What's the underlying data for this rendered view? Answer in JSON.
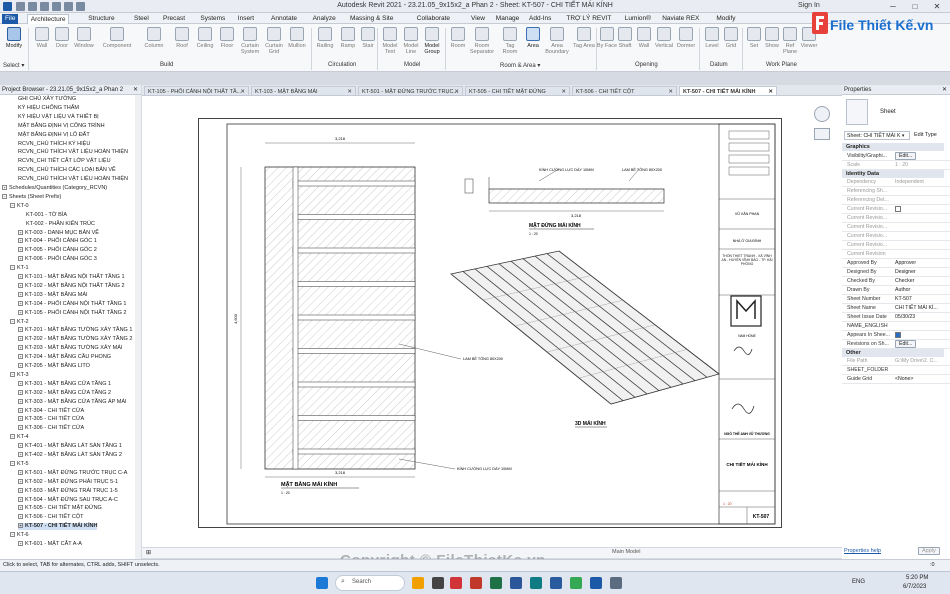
{
  "window": {
    "title": "Autodesk Revit 2021 - 23.21.05_9x15x2_a Phan 2 - Sheet: KT-507 - CHI TIẾT MÁI KÍNH",
    "sign_in": "Sign In",
    "controls": [
      "─",
      "□",
      "✕"
    ]
  },
  "menu": {
    "tabs": [
      "File",
      "Architecture",
      "Structure",
      "Steel",
      "Precast",
      "Systems",
      "Insert",
      "Annotate",
      "Analyze",
      "Massing & Site",
      "Collaborate",
      "View",
      "Manage",
      "Add-Ins",
      "TRỢ LÝ REVIT",
      "Lumion®",
      "Naviate REX",
      "Modify"
    ],
    "active": "Architecture"
  },
  "ribbon": {
    "buttons": {
      "modify": "Modify",
      "wall": "Wall",
      "door": "Door",
      "window": "Window",
      "component": "Component",
      "column": "Column",
      "roof": "Roof",
      "ceiling": "Ceiling",
      "floor": "Floor",
      "curtain_system": "Curtain System",
      "curtain_grid": "Curtain Grid",
      "mullion": "Mullion",
      "railing": "Railing",
      "ramp": "Ramp",
      "stair": "Stair",
      "model_text": "Model Text",
      "model_line": "Model Line",
      "model_group": "Model Group",
      "room": "Room",
      "room_separator": "Room Separator",
      "tag_room": "Tag Room",
      "area": "Area",
      "area_boundary": "Area Boundary",
      "tag_area": "Tag Area",
      "by_face": "By Face",
      "shaft": "Shaft",
      "wall_opening": "Wall",
      "vertical": "Vertical",
      "dormer": "Dormer",
      "level": "Level",
      "grid": "Grid",
      "set": "Set",
      "show": "Show",
      "ref_plane": "Ref Plane",
      "viewer": "Viewer"
    },
    "groups": {
      "select": "Select ▾",
      "build": "Build",
      "circulation": "Circulation",
      "model": "Model",
      "room_area": "Room & Area ▾",
      "opening": "Opening",
      "datum": "Datum",
      "work_plane": "Work Plane"
    },
    "logo_text": "File Thiết Kế.vn"
  },
  "project_browser": {
    "title": "Project Browser - 23.21.05_9x15x2_a Phan 2",
    "close": "✕",
    "items": [
      {
        "label": "GHI CHÚ XÂY TƯỜNG",
        "indent": 2
      },
      {
        "label": "KÝ HIỆU CHỐNG THẤM",
        "indent": 2
      },
      {
        "label": "KÝ HIỆU VẬT LIỆU VÀ THIẾT BỊ",
        "indent": 2
      },
      {
        "label": "MẶT BẰNG ĐỊNH VỊ CÔNG TRÌNH",
        "indent": 2
      },
      {
        "label": "MẶT BẰNG ĐỊNH VỊ LÔ ĐẤT",
        "indent": 2
      },
      {
        "label": "RCVN_CHÚ THÍCH KÝ HIỆU",
        "indent": 2
      },
      {
        "label": "RCVN_CHÚ THÍCH VẬT LIỆU HOÀN THIỆN",
        "indent": 2
      },
      {
        "label": "RCVN_CHI TIẾT CẮT LỚP VẬT LIỆU",
        "indent": 2
      },
      {
        "label": "RCVN_CHÚ THÍCH CÁC LOẠI BẢN VẼ",
        "indent": 2
      },
      {
        "label": "RCVN_CHÚ THÍCH VẬT LIỆU HOÀN THIỆN",
        "indent": 2
      },
      {
        "label": "Schedules/Quantities (Category_RCVN)",
        "indent": 0,
        "exp": "+"
      },
      {
        "label": "Sheets (Sheet Prefix)",
        "indent": 0,
        "exp": "−"
      },
      {
        "label": "KT-0",
        "indent": 1,
        "exp": "−"
      },
      {
        "label": "KT-001 - TỜ BÌA",
        "indent": 3
      },
      {
        "label": "KT-002 - PHẦN KIẾN TRÚC",
        "indent": 3
      },
      {
        "label": "KT-003 - DANH MỤC BẢN VẼ",
        "indent": 2,
        "exp": "+"
      },
      {
        "label": "KT-004 - PHỐI CẢNH GÓC 1",
        "indent": 2,
        "exp": "+"
      },
      {
        "label": "KT-005 - PHỐI CẢNH GÓC 2",
        "indent": 2,
        "exp": "+"
      },
      {
        "label": "KT-006 - PHỐI CẢNH GÓC 3",
        "indent": 2,
        "exp": "+"
      },
      {
        "label": "KT-1",
        "indent": 1,
        "exp": "−"
      },
      {
        "label": "KT-101 - MẶT BẰNG NỘI THẤT TẦNG 1",
        "indent": 2,
        "exp": "+"
      },
      {
        "label": "KT-102 - MẶT BẰNG NỘI THẤT TẦNG 2",
        "indent": 2,
        "exp": "+"
      },
      {
        "label": "KT-103 - MẶT BẰNG MÁI",
        "indent": 2,
        "exp": "+"
      },
      {
        "label": "KT-104 - PHỐI CẢNH NỘI THẤT TẦNG 1",
        "indent": 2,
        "exp": "+"
      },
      {
        "label": "KT-105 - PHỐI CẢNH NỘI THẤT TẦNG 2",
        "indent": 2,
        "exp": "+"
      },
      {
        "label": "KT-2",
        "indent": 1,
        "exp": "−"
      },
      {
        "label": "KT-201 - MẶT BẰNG TƯỜNG XÂY TẦNG 1",
        "indent": 2,
        "exp": "+"
      },
      {
        "label": "KT-202 - MẶT BẰNG TƯỜNG XÂY TẦNG 2",
        "indent": 2,
        "exp": "+"
      },
      {
        "label": "KT-203 - MẶT BẰNG TƯỜNG XÂY MÁI",
        "indent": 2,
        "exp": "+"
      },
      {
        "label": "KT-204 - MẶT BẰNG CẦU PHONG",
        "indent": 2,
        "exp": "+"
      },
      {
        "label": "KT-205 - MẶT BẰNG LITO",
        "indent": 2,
        "exp": "+"
      },
      {
        "label": "KT-3",
        "indent": 1,
        "exp": "−"
      },
      {
        "label": "KT-301 - MẶT BẰNG CỬA TẦNG 1",
        "indent": 2,
        "exp": "+"
      },
      {
        "label": "KT-302 - MẶT BẰNG CỬA TẦNG 2",
        "indent": 2,
        "exp": "+"
      },
      {
        "label": "KT-303 - MẶT BẰNG CỬA TẦNG ÁP MÁI",
        "indent": 2,
        "exp": "+"
      },
      {
        "label": "KT-304 - CHI TIẾT CỬA",
        "indent": 2,
        "exp": "+"
      },
      {
        "label": "KT-305 - CHI TIẾT CỬA",
        "indent": 2,
        "exp": "+"
      },
      {
        "label": "KT-306 - CHI TIẾT CỬA",
        "indent": 2,
        "exp": "+"
      },
      {
        "label": "KT-4",
        "indent": 1,
        "exp": "−"
      },
      {
        "label": "KT-401 - MẶT BẰNG LÁT SÀN TẦNG 1",
        "indent": 2,
        "exp": "+"
      },
      {
        "label": "KT-402 - MẶT BẰNG LÁT SÀN TẦNG 2",
        "indent": 2,
        "exp": "+"
      },
      {
        "label": "KT-5",
        "indent": 1,
        "exp": "−"
      },
      {
        "label": "KT-501 - MẶT ĐỨNG TRƯỚC TRỤC C-A",
        "indent": 2,
        "exp": "+"
      },
      {
        "label": "KT-502 - MẶT ĐỨNG PHẢI TRỤC 5-1",
        "indent": 2,
        "exp": "+"
      },
      {
        "label": "KT-503 - MẶT ĐỨNG TRÁI TRỤC 1-5",
        "indent": 2,
        "exp": "+"
      },
      {
        "label": "KT-504 - MẶT ĐỨNG SAU TRỤC A-C",
        "indent": 2,
        "exp": "+"
      },
      {
        "label": "KT-505 - CHI TIẾT MẶT ĐỨNG",
        "indent": 2,
        "exp": "+"
      },
      {
        "label": "KT-506 - CHI TIẾT CỘT",
        "indent": 2,
        "exp": "+"
      },
      {
        "label": "KT-507 - CHI TIẾT MÁI KÍNH",
        "indent": 2,
        "exp": "+",
        "selected": true
      },
      {
        "label": "KT-6",
        "indent": 1,
        "exp": "−"
      },
      {
        "label": "KT-601 - MẶT CẮT A-A",
        "indent": 2,
        "exp": "+"
      }
    ]
  },
  "doc_tabs": [
    {
      "label": "KT-105 - PHỐI CẢNH NỘI THẤT TẦ..."
    },
    {
      "label": "KT-103 - MẶT BẰNG MÁI"
    },
    {
      "label": "KT-501 - MẶT ĐỨNG TRƯỚC TRỤC..."
    },
    {
      "label": "KT-505 - CHI TIẾT MẶT ĐỨNG"
    },
    {
      "label": "KT-506 - CHI TIẾT CỘT"
    },
    {
      "label": "KT-507 - CHI TIẾT MÁI KÍNH",
      "active": true
    }
  ],
  "drawing": {
    "plan_title": "MẶT BẰNG MÁI KÍNH",
    "plan_scale": "1 : 20",
    "elev_title": "MẶT ĐỨNG MÁI KÍNH",
    "elev_scale": "1 : 20",
    "iso_title": "3D MÁI KÍNH",
    "note_glass": "KÍNH CƯỜNG LỰC DÀY 10MM",
    "note_beam": "LAM BÊ TÔNG 80X200",
    "note_beam2": "LAM BÊ TÔNG 80X200",
    "note_glass2": "KÍNH CƯỜNG LỰC DÀY 10MM",
    "dim_top": "3,218",
    "dim_bottom": "3,218",
    "dim_side": "4,600",
    "dim_elev": "3,218",
    "tb_owner": "VŨ VĂN PHAN",
    "tb_project_type": "NHÀ Ở GIA ĐÌNH",
    "tb_location": "THÔN THIẾT TRANH - XÃ VĨNH AN - HUYỆN VĨNH BẢO - TP. HẢI PHÒNG",
    "tb_company": "NAM HOME",
    "tb_signer": "NGÔ THẾ ANH VŨ THƯƠNG",
    "tb_sheet_title": "CHI TIẾT MÁI KÍNH",
    "tb_scale": "1 : 20",
    "tb_sheet_no": "KT-507"
  },
  "properties": {
    "title": "Properties",
    "close": "✕",
    "type_name": "Sheet",
    "selector": "Sheet: CHI TIẾT MÁI K ▾",
    "edit_type": "Edit Type",
    "sections": {
      "graphics": "Graphics",
      "identity": "Identity Data",
      "other": "Other"
    },
    "rows": {
      "visibility": {
        "k": "Visibility/Graphi...",
        "v": "Edit..."
      },
      "scale": {
        "k": "Scale",
        "v": "1 : 20"
      },
      "dependency": {
        "k": "Dependency",
        "v": "Independent"
      },
      "ref_sheet": {
        "k": "Referencing Sh...",
        "v": ""
      },
      "ref_detail": {
        "k": "Referencing Det...",
        "v": ""
      },
      "cur_rev1": {
        "k": "Current Revisio...",
        "v": ""
      },
      "cur_rev2": {
        "k": "Current Revisio...",
        "v": ""
      },
      "cur_rev3": {
        "k": "Current Revisio...",
        "v": ""
      },
      "cur_rev4": {
        "k": "Current Revisio...",
        "v": ""
      },
      "cur_rev5": {
        "k": "Current Revisio...",
        "v": ""
      },
      "cur_rev6": {
        "k": "Current Revision",
        "v": ""
      },
      "approved": {
        "k": "Approved By",
        "v": "Approver"
      },
      "designed": {
        "k": "Designed By",
        "v": "Designer"
      },
      "checked": {
        "k": "Checked By",
        "v": "Checker"
      },
      "drawn": {
        "k": "Drawn By",
        "v": "Author"
      },
      "sheet_number": {
        "k": "Sheet Number",
        "v": "KT-507"
      },
      "sheet_name": {
        "k": "Sheet Name",
        "v": "CHI TIẾT MÁI KÍ..."
      },
      "issue_date": {
        "k": "Sheet Issue Date",
        "v": "05/30/23"
      },
      "name_english": {
        "k": "NAME_ENGLISH",
        "v": ""
      },
      "appears": {
        "k": "Appears In Shee...",
        "v": ""
      },
      "revisions": {
        "k": "Revisions on Sh...",
        "v": "Edit..."
      },
      "file_path": {
        "k": "File Path",
        "v": "G:\\My Drive\\2. C..."
      },
      "sheet_folder": {
        "k": "SHEET_FOLDER",
        "v": ""
      },
      "guide_grid": {
        "k": "Guide Grid",
        "v": "<None>"
      }
    },
    "help": "Properties help",
    "apply": "Apply"
  },
  "viewbar": {
    "model": "Main Model"
  },
  "status": {
    "hint": "Click to select, TAB for alternates, CTRL adds, SHIFT unselects.",
    "filter": ":0"
  },
  "taskbar": {
    "search": "Search",
    "lang": "ENG",
    "time": "5:20 PM",
    "date": "6/7/2023"
  },
  "watermark": "Copyright © FileThietKe.vn",
  "colors": {
    "accent": "#1c5aa8",
    "selected": "#cfe0f5",
    "logo_red": "#e8403a",
    "logo_blue": "#1b6fcf"
  }
}
